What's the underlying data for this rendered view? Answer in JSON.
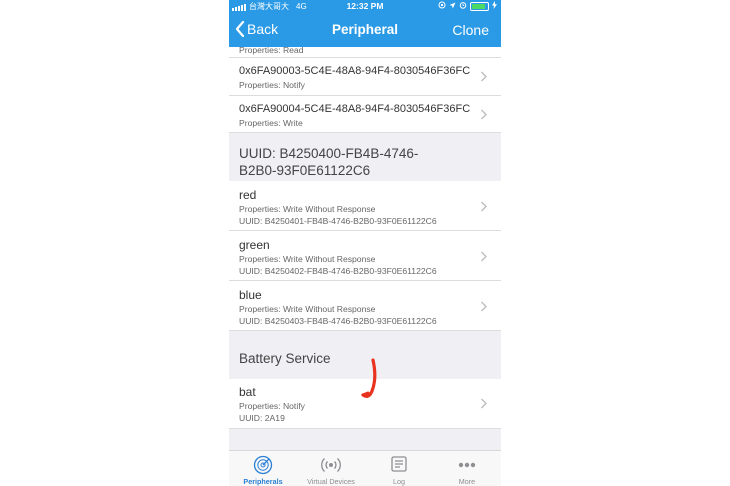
{
  "status": {
    "carrier": "台灣大哥大",
    "network": "4G",
    "time": "12:32 PM"
  },
  "nav": {
    "back_label": "Back",
    "title": "Peripheral",
    "right_label": "Clone"
  },
  "partial_row": {
    "props": "Properties: Read"
  },
  "top_rows": [
    {
      "title": "0x6FA90003-5C4E-48A8-94F4-8030546F36FC",
      "props": "Properties: Notify"
    },
    {
      "title": "0x6FA90004-5C4E-48A8-94F4-8030546F36FC",
      "props": "Properties: Write"
    }
  ],
  "service1": {
    "header_line1": "UUID: B4250400-FB4B-4746-",
    "header_line2": "B2B0-93F0E61122C6",
    "rows": [
      {
        "title": "red",
        "props": "Properties: Write Without Response",
        "uuid": "UUID: B4250401-FB4B-4746-B2B0-93F0E61122C6"
      },
      {
        "title": "green",
        "props": "Properties: Write Without Response",
        "uuid": "UUID: B4250402-FB4B-4746-B2B0-93F0E61122C6"
      },
      {
        "title": "blue",
        "props": "Properties: Write Without Response",
        "uuid": "UUID: B4250403-FB4B-4746-B2B0-93F0E61122C6"
      }
    ]
  },
  "service2": {
    "header": "Battery Service",
    "rows": [
      {
        "title": "bat",
        "props": "Properties: Notify",
        "uuid": "UUID: 2A19"
      }
    ]
  },
  "tabs": [
    {
      "label": "Peripherals",
      "icon": "radar-icon",
      "active": true
    },
    {
      "label": "Virtual Devices",
      "icon": "broadcast-icon",
      "active": false
    },
    {
      "label": "Log",
      "icon": "log-icon",
      "active": false
    },
    {
      "label": "More",
      "icon": "more-icon",
      "active": false
    }
  ],
  "colors": {
    "accent": "#2b9ae6",
    "active_tab": "#2b7fd4",
    "annotation": "#e8321e",
    "battery": "#4cd964"
  }
}
